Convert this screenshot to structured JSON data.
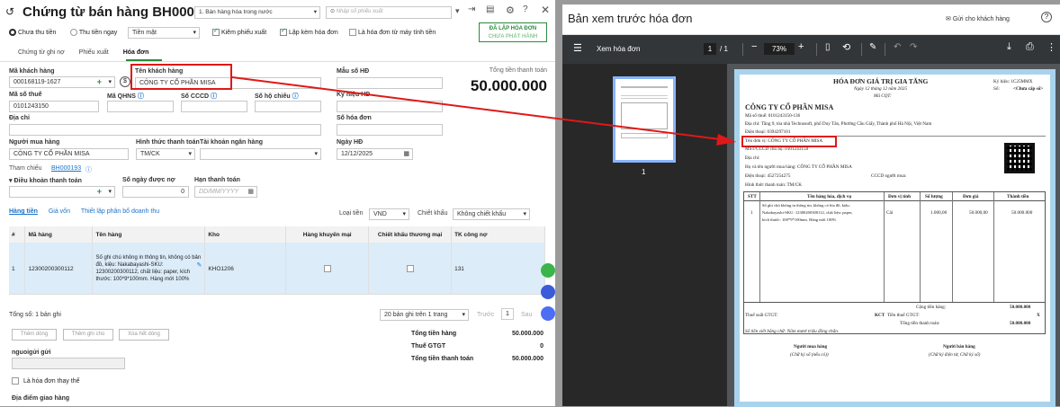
{
  "left": {
    "title": "Chứng từ bán hàng BH000193",
    "type_select": "1. Bán hàng hóa trong nước",
    "search_placeholder": "Nhập số phiếu xuất",
    "radio_unpaid": "Chưa thu tiền",
    "radio_paid": "Thu tiền ngay",
    "pay_method": "Tiền mặt",
    "chk_export": "Kiêm phiếu xuất",
    "chk_invoice": "Lập kèm hóa đơn",
    "chk_cashreg": "Là hóa đơn từ máy tính tiền",
    "issue_btn_1": "ĐÃ LẬP HÓA ĐƠN",
    "issue_btn_2": "CHƯA PHÁT HÀNH",
    "tabs": [
      "Chứng từ ghi nợ",
      "Phiếu xuất",
      "Hóa đơn"
    ],
    "lbl_customer_code": "Mã khách hàng",
    "customer_code": "000168119-1627",
    "lbl_customer_name": "Tên khách hàng",
    "customer_name": "CÔNG TY CỔ PHẦN MISA",
    "lbl_invoice_no": "Mẫu số HĐ",
    "lbl_total": "Tổng tiền thanh toán",
    "total": "50.000.000",
    "lbl_tax": "Mã số thuế",
    "tax": "0101243150",
    "lbl_qhns": "Mã QHNS",
    "lbl_cccd": "Số CCCD",
    "lbl_passport": "Số hộ chiếu",
    "lbl_symbol": "Ký hiệu HĐ",
    "lbl_address": "Địa chỉ",
    "lbl_inv_number": "Số hóa đơn",
    "lbl_buyer": "Người mua hàng",
    "buyer": "CÔNG TY CỔ PHẦN MISA",
    "lbl_pay_form": "Hình thức thanh toán",
    "pay_form": "TM/CK",
    "lbl_bank": "Tài khoản ngân hàng",
    "lbl_date": "Ngày HĐ",
    "date": "12/12/2025",
    "lbl_ref": "Tham chiếu",
    "ref": "BH000193",
    "lbl_terms": "Điều khoản thanh toán",
    "lbl_days": "Số ngày được nợ",
    "days": "0",
    "lbl_due": "Hạn thanh toán",
    "due_placeholder": "DD/MM/YYYY",
    "subtabs": [
      "Hàng tiền",
      "Giá vốn",
      "Thiết lập phân bổ doanh thu"
    ],
    "lbl_currency": "Loại tiền",
    "currency": "VND",
    "lbl_discount": "Chiết khấu",
    "discount": "Không chiết khấu",
    "cols": [
      "#",
      "Mã hàng",
      "Tên hàng",
      "Kho",
      "Hàng khuyến mại",
      "Chiết khấu thương mại",
      "TK công nợ"
    ],
    "row": {
      "no": "1",
      "code": "12300200300112",
      "name": "Số ghi chú không in thông tin, không có bản đồ, kiệu: Nakabayashi-SKU: 12300200300112, chất liệu: paper, kích thước: 100*9*100mm. Hàng mới 100%",
      "kho": "KHO1206",
      "tk": "131"
    },
    "total_rows": "Tổng số: 1 bản ghi",
    "pager": "20 bản ghi trên 1 trang",
    "prev": "Trước",
    "page": "1",
    "next": "Sau",
    "btn_add": "Thêm dòng",
    "btn_note": "Thêm ghi chú",
    "btn_del": "Xóa hết dòng",
    "sum_goods_lbl": "Tổng tiền hàng",
    "sum_goods": "50.000.000",
    "sum_vat_lbl": "Thuế GTGT",
    "sum_vat": "0",
    "sum_total_lbl": "Tổng tiền thanh toán",
    "sum_total": "50.000.000",
    "lbl_sender": "nguoigửi gửi",
    "chk_replace": "Là hóa đơn thay thế",
    "lbl_delivery": "Địa điểm giao hàng"
  },
  "viewer": {
    "title": "Bản xem trước hóa đơn",
    "send": "Gửi cho khách hàng",
    "toolbar_title": "Xem hóa đơn",
    "page": "1",
    "pages": "/ 1",
    "zoom": "73%",
    "thumb_num": "1",
    "inv": {
      "heading": "HÓA ĐƠN GIÁ TRỊ GIA TĂNG",
      "date": "Ngày 12 tháng 12 năm 2025",
      "code": "Mã CQT:",
      "symbol": "Ký hiệu: 1C25MMX",
      "no": "Số:",
      "no_val": "<Chưa cấp số>",
      "seller": "CÔNG TY CỔ PHẦN MISA",
      "seller_tax": "Mã số thuế: 0101243150-136",
      "seller_addr": "Địa chỉ: Tầng 9, tòa nhà Technosoft, phố Duy Tân, Phường Cầu Giấy, Thành phố Hà Nội, Việt Nam",
      "seller_phone": "Điện thoại: 0394297101",
      "buyer_unit": "Tên đơn vị: CÔNG TY CỔ PHẦN MISA",
      "buyer_tax": "MST/CCCD chủ hộ: 0101243150",
      "buyer_addr": "Địa chỉ:",
      "buyer_name": "Họ và tên người mua hàng: CÔNG TY CỔ PHẦN MISA",
      "buyer_phone": "Điện thoại: 4527254275",
      "buyer_cccd": "CCCD người mua:",
      "pay_form": "Hình thức thanh toán: TM/CK",
      "cols": [
        "STT",
        "Tên hàng hóa, dịch vụ",
        "Đơn vị tính",
        "Số lượng",
        "Đơn giá",
        "Thành tiền"
      ],
      "row_no": "1",
      "row_name_1": "Sổ ghi chú không in thông tin, không có bìa đồ, kiệu:",
      "row_name_2": "Nakabayashi-SKU: 12300200300112, chất liệu: paper,",
      "row_name_3": "kích thước: 100*9*100mm. Hàng mới 100%",
      "row_unit": "Cái",
      "row_qty": "1.000,00",
      "row_price": "50.000,00",
      "row_amount": "50.000.000",
      "sum_goods_lbl": "Cộng tiền hàng:",
      "sum_goods": "50.000.000",
      "vat_rate": "Thuế suất GTGT:",
      "vat_kct": "KCT",
      "vat_lbl": "Tiền thuế GTGT:",
      "vat": "X",
      "total_lbl": "Tổng tiền thanh toán:",
      "total": "50.000.000",
      "words": "Số tiền viết bằng chữ: Năm mươi triệu đồng chẵn.",
      "sign_buyer": "Người mua hàng",
      "sign_buyer_sub": "(Chữ ký số (nếu có))",
      "sign_seller": "Người bán hàng",
      "sign_seller_sub": "(Chữ ký điện tử, Chữ ký số)"
    }
  },
  "colors": {
    "accent": "#1a73c8",
    "annotation": "#e01818",
    "green": "#2b8a3e"
  }
}
